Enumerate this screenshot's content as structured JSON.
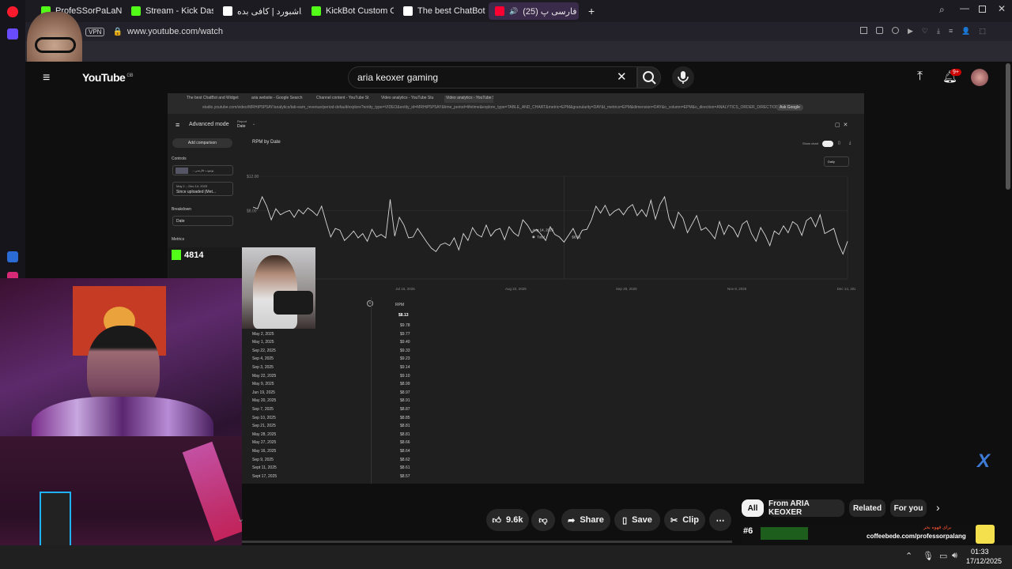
{
  "browser": {
    "tabs": [
      {
        "label": "ProfeSSorPaLaNg Stream",
        "color": "#53fc18"
      },
      {
        "label": "Stream - Kick Dashboard",
        "color": "#53fc18"
      },
      {
        "label": "داشبورد | کافی بده",
        "color": "#ffffff"
      },
      {
        "label": "KickBot Custom Comman",
        "color": "#53fc18"
      },
      {
        "label": "The best ChatBot and Wid",
        "color": "#ffffff"
      },
      {
        "label": "(25) آیا یوتیوب فارسی پ",
        "color": "#ff0033"
      }
    ],
    "url": "www.youtube.com/watch",
    "vpn_label": "VPN"
  },
  "youtube": {
    "logo_text": "YouTube",
    "region": "GB",
    "search_query": "aria keoxer gaming",
    "notifications_badge": "9+"
  },
  "studio": {
    "inner_tabs": [
      "The best ChatBot and Widget",
      "aria website - Google Search",
      "Channel content - YouTube St",
      "Video analytics - YouTube Stu",
      "Video analytics - YouTube Stu"
    ],
    "inner_url": "studio.youtube.com/video/MRHtP5P5AY/analytics/tab-earn_revenue/period-default/explore?entity_type=VIDEO&entity_id=MRHtP5P5AY&time_period=lifetime&explore_type=TABLE_AND_CHART&metric=EPM&granularity=DAY&t_metrics=EPM&dimension=DAY&o_column=EPM&o_direction=ANALYTICS_ORDER_DIRECTION_DESC",
    "ask_google": "Ask Google",
    "mode": "Advanced mode",
    "report_label": "Report",
    "report_value": "Date",
    "add_comparison": "Add comparison",
    "controls_label": "Controls",
    "video_select": "...یوتیوب فارسی",
    "date_range_line1": "May 1 – Dec 14, 2025",
    "date_range_line2": "Since uploaded (Met...",
    "breakdown_label": "Breakdown",
    "breakdown_value": "Date",
    "metrics_label": "Metrics",
    "chart_title": "RPM by Date",
    "show_chart": "Show chart",
    "granularity": "Daily",
    "table_header": "RPM",
    "table_total": "$8.13",
    "tooltip_date": "Aug 14, 2025",
    "tooltip_total": "Total",
    "tooltip_value": "$8.91",
    "rows": [
      {
        "date": "",
        "value": "$9.78"
      },
      {
        "date": "May 2, 2025",
        "value": "$9.77"
      },
      {
        "date": "May 1, 2025",
        "value": "$9.40"
      },
      {
        "date": "Sep 22, 2025",
        "value": "$9.33"
      },
      {
        "date": "Sep 4, 2025",
        "value": "$9.23"
      },
      {
        "date": "Sep 3, 2025",
        "value": "$9.14"
      },
      {
        "date": "May 22, 2025",
        "value": "$9.10"
      },
      {
        "date": "May 9, 2025",
        "value": "$8.99"
      },
      {
        "date": "Jun 19, 2025",
        "value": "$8.97"
      },
      {
        "date": "May 20, 2025",
        "value": "$8.91"
      },
      {
        "date": "Sep 7, 2025",
        "value": "$8.87"
      },
      {
        "date": "Sep 10, 2025",
        "value": "$8.85"
      },
      {
        "date": "Sep 21, 2025",
        "value": "$8.81"
      },
      {
        "date": "May 28, 2025",
        "value": "$8.81"
      },
      {
        "date": "May 27, 2025",
        "value": "$8.66"
      },
      {
        "date": "May 16, 2025",
        "value": "$8.64"
      },
      {
        "date": "Sep 9, 2025",
        "value": "$8.62"
      },
      {
        "date": "Sept 11, 2025",
        "value": "$8.61"
      },
      {
        "date": "Sept 17, 2025",
        "value": "$8.57"
      }
    ]
  },
  "chart_data": {
    "type": "line",
    "title": "RPM by Date",
    "x_tick_labels": [
      "Jun 9, 2025",
      "Jul 16, 2025",
      "Aug 22, 2025",
      "Sep 28, 2025",
      "Nov 8, 2025",
      "Dec 14, 2025"
    ],
    "y_tick_labels": [
      "$12.00",
      "$8.00"
    ],
    "ylim": [
      0,
      12
    ],
    "series": [
      {
        "values": [
          8.4,
          8.2,
          9.6,
          8.5,
          6.9,
          8.2,
          7.5,
          7.8,
          8.0,
          7.2,
          8.1,
          7.6,
          8.3,
          7.9,
          7.4,
          8.5,
          6.6,
          4.9,
          5.9,
          5.7,
          4.5,
          5.0,
          5.6,
          4.8,
          5.3,
          4.4,
          5.8,
          4.9,
          5.2,
          4.8,
          9.3,
          5.0,
          7.2,
          6.3,
          4.8,
          4.9,
          5.9,
          5.1,
          4.3,
          3.6,
          3.2,
          4.0,
          4.2,
          3.9,
          4.8,
          3.4,
          5.3,
          4.5,
          6.0,
          5.2,
          4.9,
          6.3,
          5.0,
          5.7,
          5.9,
          4.6,
          6.1,
          5.4,
          5.0,
          6.9,
          6.3,
          5.4,
          5.8,
          5.2,
          4.5,
          6.1,
          5.2,
          4.9,
          4.3,
          5.1,
          5.9,
          4.7,
          5.7,
          5.8,
          6.9,
          8.5,
          7.7,
          8.6,
          7.4,
          7.9,
          8.2,
          7.5,
          8.3,
          8.7,
          7.4,
          8.1,
          7.3,
          9.2,
          7.0,
          8.7,
          9.6,
          7.0,
          5.9,
          7.8,
          7.1,
          5.4,
          6.4,
          7.4,
          5.7,
          6.0,
          5.4,
          4.7,
          6.7,
          5.2,
          6.3,
          5.9,
          4.9,
          6.4,
          6.8,
          5.3,
          4.4,
          6.0,
          5.1,
          3.9,
          5.6,
          5.2,
          6.2,
          5.4,
          6.7,
          6.3,
          5.1,
          6.8,
          7.2,
          6.1,
          7.5,
          5.3,
          5.6,
          5.9,
          4.1,
          2.9,
          4.4
        ]
      }
    ],
    "grid": true,
    "legend": "none"
  },
  "cam_overlay": {
    "kick_count": "4814"
  },
  "actions": {
    "likes": "9.6k",
    "share": "Share",
    "save": "Save",
    "clip": "Clip",
    "chips": [
      "All",
      "From ARIA KEOXER",
      "Related",
      "For you"
    ]
  },
  "promo": {
    "rank": "#6",
    "handle": "coffeebede.com/professorpalang",
    "title_fa": "برای قهوه بخر"
  },
  "taskbar": {
    "time": "01:33",
    "date": "17/12/2025"
  }
}
